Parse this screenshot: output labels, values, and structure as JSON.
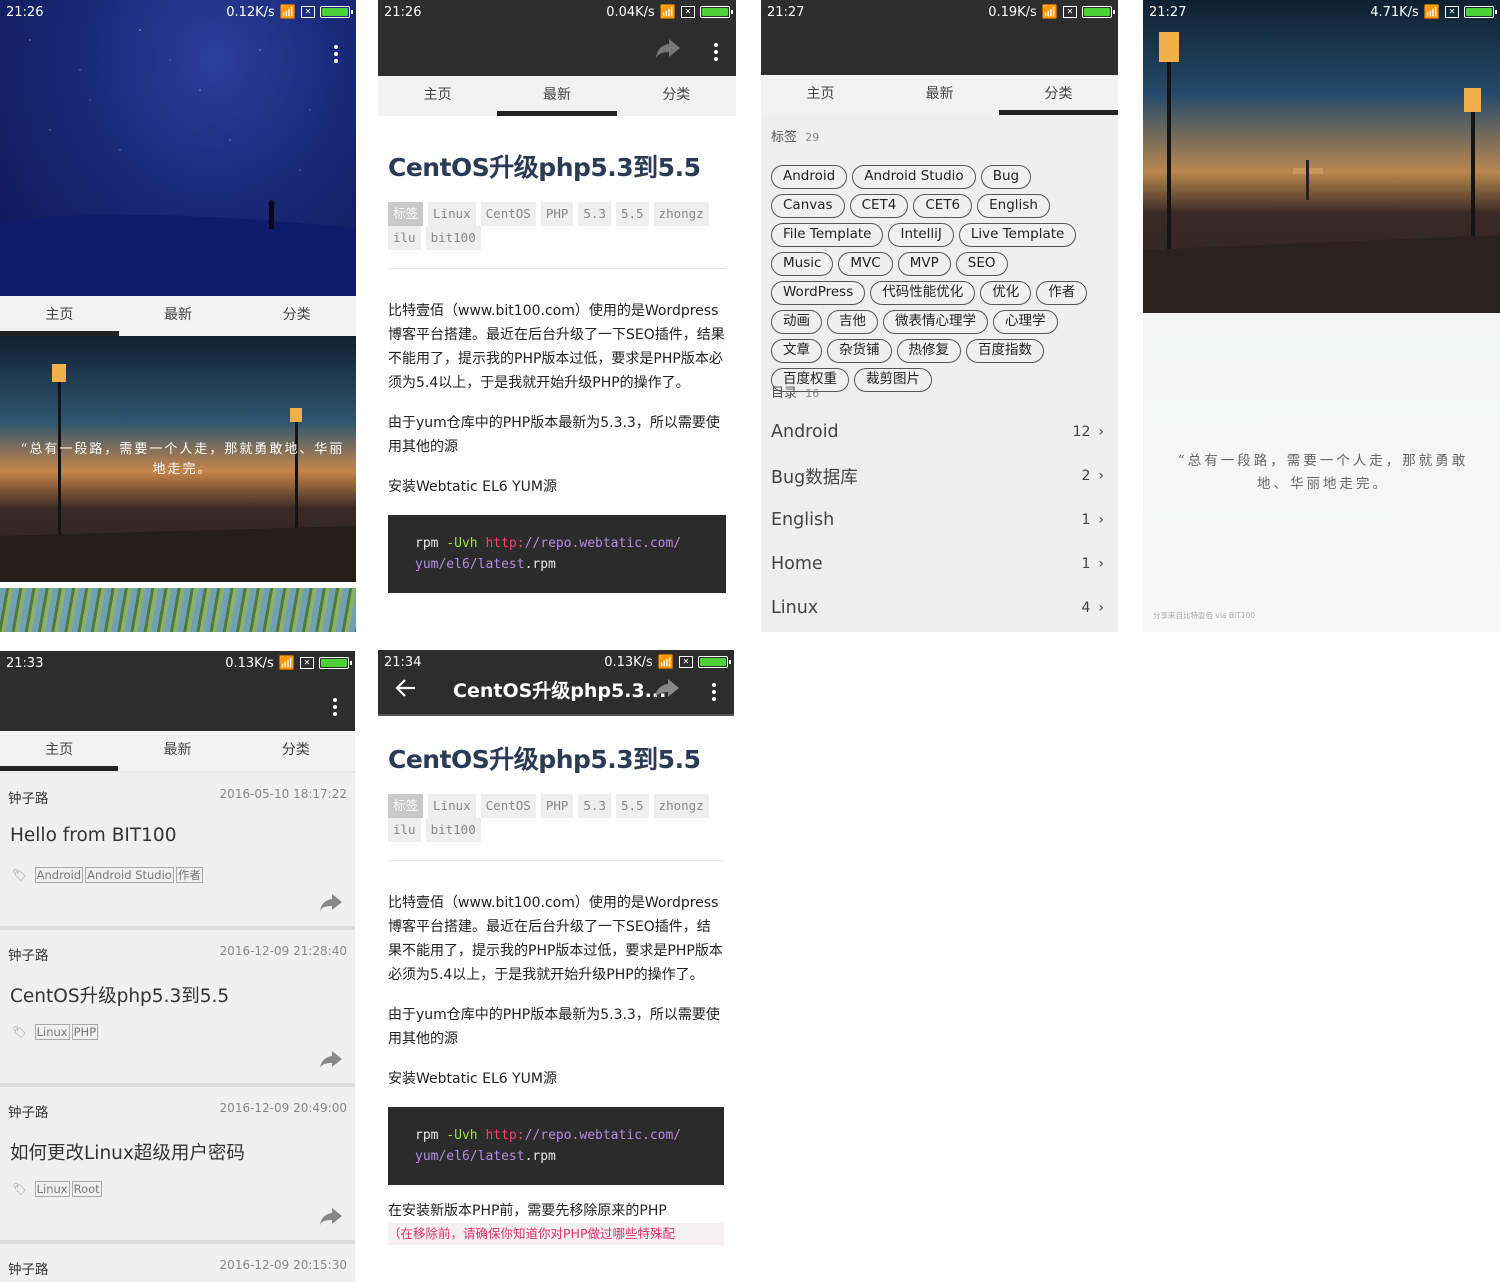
{
  "colors": {
    "bar": "#2d2d2d",
    "accent": "#222222",
    "code_bg": "#2b2b2b",
    "battery": "#4cd137",
    "warn": "#e0316b"
  },
  "tabs": [
    "主页",
    "最新",
    "分类"
  ],
  "screens": {
    "s1": {
      "time": "21:26",
      "speed": "0.12K/s",
      "quote": "“总有一段路，需要一个人走，那就勇敢地、华丽地走完。"
    },
    "s2": {
      "time": "21:26",
      "speed": "0.04K/s"
    },
    "s3": {
      "time": "21:27",
      "speed": "0.19K/s"
    },
    "s4": {
      "time": "21:27",
      "speed": "4.71K/s",
      "quote": "“总有一段路，需要一个人走，那就勇敢地、华丽地走完。",
      "footer": "分享来自比特壹佰 via BIT100"
    },
    "s5": {
      "time": "21:33",
      "speed": "0.13K/s"
    },
    "s6": {
      "time": "21:34",
      "speed": "0.13K/s",
      "appbar_title": "CentOS升级php5.3..."
    }
  },
  "article": {
    "title": "CentOS升级php5.3到5.5",
    "tag_label": "标签",
    "tags": [
      "Linux",
      "CentOS",
      "PHP",
      "5.3",
      "5.5",
      "zhongz",
      "ilu",
      "bit100"
    ],
    "p1": "比特壹佰（www.bit100.com）使用的是Wordpress博客平台搭建。最近在后台升级了一下SEO插件，结果不能用了，提示我的PHP版本过低，要求是PHP版本必须为5.4以上，于是我就开始升级PHP的操作了。",
    "p2": "由于yum仓库中的PHP版本最新为5.3.3，所以需要使用其他的源",
    "p3": "安装Webtatic EL6 YUM源",
    "code_cmd": "rpm",
    "code_flag": "-Uvh",
    "code_proto": "http:",
    "code_host": "//repo.webtatic.com/",
    "code_path": "yum/el6/latest",
    "code_ext": ".rpm",
    "p4": "在安装新版本PHP前，需要先移除原来的PHP",
    "p5": "（在移除前，请确保你知道你对PHP做过哪些特殊配"
  },
  "categories": {
    "tags_label": "标签",
    "tags_count": "29",
    "tags": [
      "Android",
      "Android Studio",
      "Bug",
      "Canvas",
      "CET4",
      "CET6",
      "English",
      "File Template",
      "IntelliJ",
      "Live Template",
      "Music",
      "MVC",
      "MVP",
      "SEO",
      "WordPress",
      "代码性能优化",
      "优化",
      "作者",
      "动画",
      "吉他",
      "微表情心理学",
      "心理学",
      "文章",
      "杂货铺",
      "热修复",
      "百度指数",
      "百度权重",
      "裁剪图片"
    ],
    "dirs_label": "目录",
    "dirs_count": "16",
    "dirs": [
      {
        "name": "Android",
        "count": "12"
      },
      {
        "name": "Bug数据库",
        "count": "2"
      },
      {
        "name": "English",
        "count": "1"
      },
      {
        "name": "Home",
        "count": "1"
      },
      {
        "name": "Linux",
        "count": "4"
      }
    ]
  },
  "posts": [
    {
      "author": "钟子路",
      "date": "2016-05-10 18:17:22",
      "title": "Hello from BIT100",
      "tags": [
        "Android",
        "Android Studio",
        "作者"
      ]
    },
    {
      "author": "钟子路",
      "date": "2016-12-09 21:28:40",
      "title": "CentOS升级php5.3到5.5",
      "tags": [
        "Linux",
        "PHP"
      ]
    },
    {
      "author": "钟子路",
      "date": "2016-12-09 20:49:00",
      "title": "如何更改Linux超级用户密码",
      "tags": [
        "Linux",
        "Root"
      ]
    },
    {
      "author": "钟子路",
      "date": "2016-12-09 20:15:30",
      "title": "",
      "tags": []
    }
  ]
}
